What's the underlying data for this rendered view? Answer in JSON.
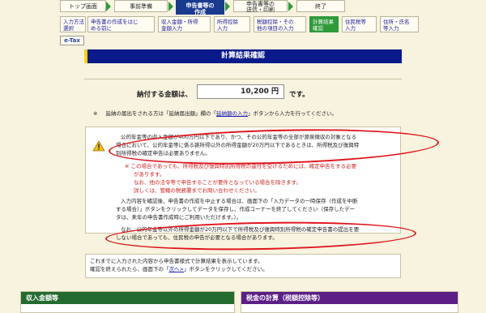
{
  "steps_major": [
    {
      "label": "トップ画面"
    },
    {
      "label": "事前準備"
    },
    {
      "label": "申告書等の\n作成",
      "active": true
    },
    {
      "label": "申告書等の\n送信・印刷"
    },
    {
      "label": "終了"
    }
  ],
  "steps_minor": [
    {
      "label": "入力方法\n選択"
    },
    {
      "label": "申告書の作成をはじ\nめる前に"
    },
    {
      "label": "収入金額・所得\n金額入力"
    },
    {
      "label": "所得控除\n入力"
    },
    {
      "label": "税額控除・その\n他の項目の入力"
    },
    {
      "label": "計算結果\n確認",
      "active": true
    },
    {
      "label": "住民税等\n入力"
    },
    {
      "label": "住所・氏名\n等入力"
    }
  ],
  "etax_label": "e-Tax",
  "page_title": "計算結果確認",
  "amount": {
    "label": "納付する金額は、",
    "value": "10,200 円",
    "suffix": "です。"
  },
  "note": {
    "mark": "※",
    "text_before": "延納の届出をされる方は「延納届出額」欄の「",
    "link_text": "延納額の入力",
    "text_after": "」ボタンから入力を行ってください。"
  },
  "warning": {
    "main_text_1": "公的年金等の収入金額が400万円以下であり、かつ、その公的年金等の全部が源泉徴収の対象となる",
    "main_text_2": "場合において、公的年金等に係る雑所得以外の所得金額が20万円以下であるときは、所得税及び復興特",
    "main_text_3": "別所得税の確定申告は必要ありません。",
    "red_1": "※ この場合であっても、所得税及び復興特別所得税の還付を受けるためには、確定申告をする必要",
    "red_2": "があります。",
    "red_3": "なお、他の法令等で申告することが要件となっている場合を除きます。",
    "red_4": "詳しくは、管轄の税務署までお問い合わせください。",
    "info_1": "入力内容を確認後、申告書の作成を中止する場合は、画面下の「入力データの一時保存（作成を中断",
    "info_2": "する場合）」ボタンをクリックしてデータを保存し、作成コーナーを終了してください（保存したデー",
    "info_3": "タは、来年の申告書作成時にご利用いただけます。）。",
    "resident_1": "なお、公的年金等以外の所得金額が20万円以下で所得税及び復興特別所得税の確定申告書の提出を要",
    "resident_2": "しない場合であっても、住民税の申告が必要となる場合があります。"
  },
  "info": {
    "line1": "これまでに入力された内容から申告書様式で計算結果を表示しています。",
    "line2_before": "確認を終えられたら、画面下の「",
    "line2_link": "次へ>",
    "line2_after": "」ボタンをクリックしてください。"
  },
  "sections": {
    "income_title": "収入金額等",
    "tax_title": "税金の計算（税額控除等）"
  },
  "colors": {
    "nav_blue": "#193a8f",
    "step_green": "#2f9a3a",
    "title_navy": "#0b1a8a",
    "annotation_red": "#e0141b",
    "section_green": "#236b2f",
    "section_purple": "#5b1f86"
  }
}
